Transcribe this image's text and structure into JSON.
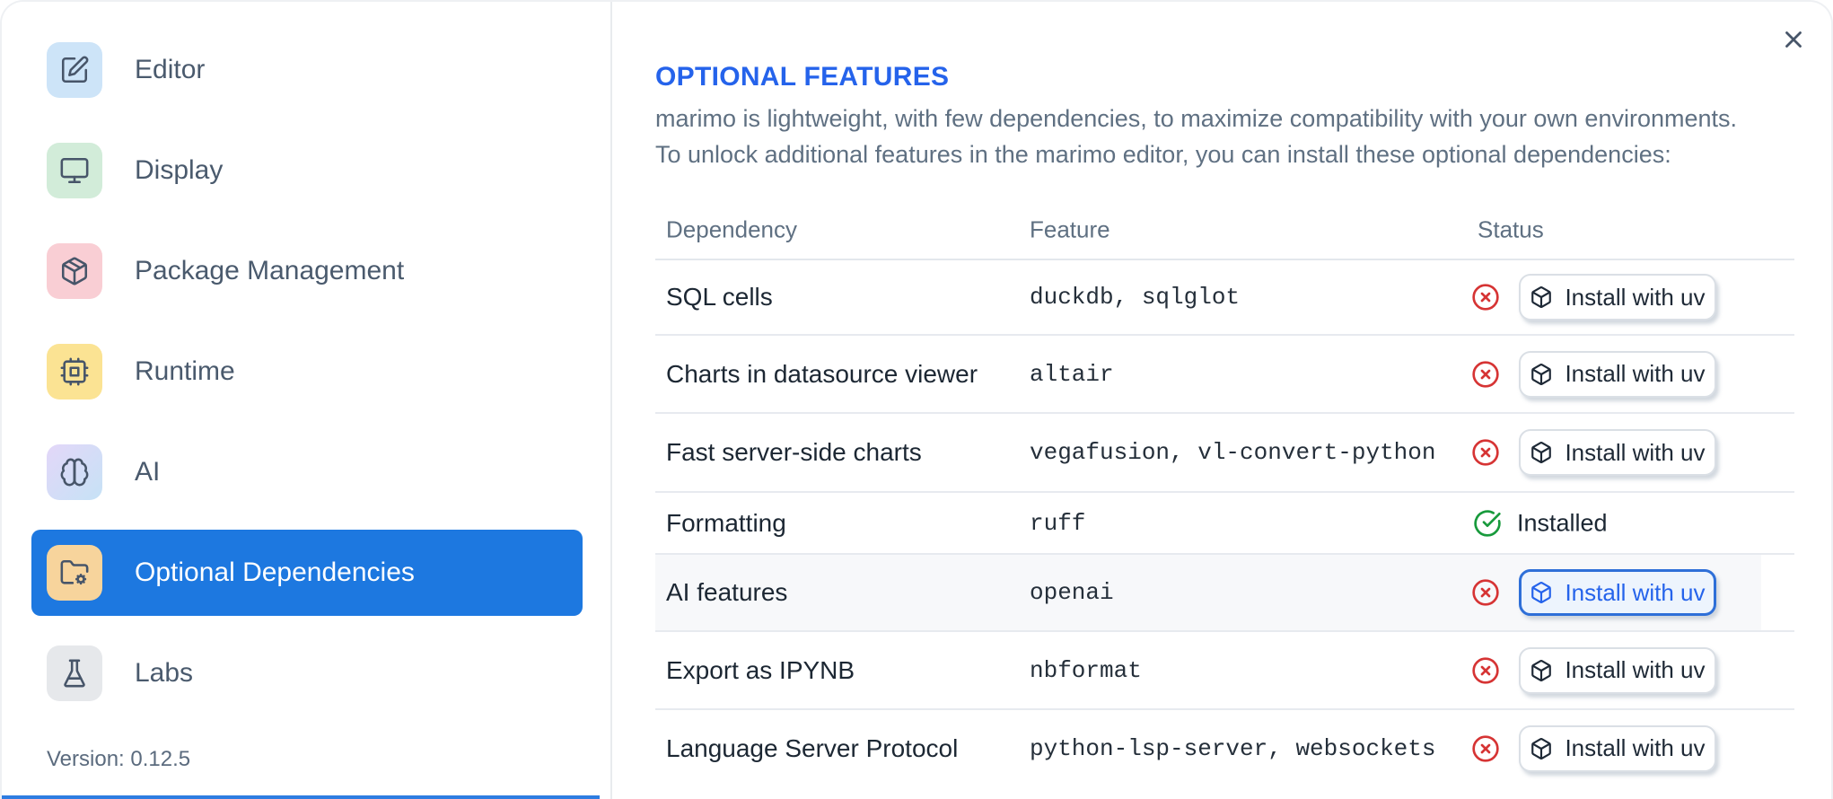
{
  "sidebar": {
    "items": [
      {
        "label": "Editor",
        "icon": "pencil-square"
      },
      {
        "label": "Display",
        "icon": "monitor"
      },
      {
        "label": "Package Management",
        "icon": "package"
      },
      {
        "label": "Runtime",
        "icon": "cpu"
      },
      {
        "label": "AI",
        "icon": "brain"
      },
      {
        "label": "Optional Dependencies",
        "icon": "folder-cog",
        "selected": true
      },
      {
        "label": "Labs",
        "icon": "flask"
      }
    ],
    "version_label": "Version: 0.12.5"
  },
  "dialog": {
    "title": "OPTIONAL FEATURES",
    "description_line1": "marimo is lightweight, with few dependencies, to maximize compatibility with your own environments.",
    "description_line2": "To unlock additional features in the marimo editor, you can install these optional dependencies:",
    "close_icon": "x"
  },
  "table": {
    "columns": [
      "Dependency",
      "Feature",
      "Status"
    ],
    "rows": [
      {
        "dependency": "SQL cells",
        "feature": "duckdb, sqlglot",
        "installed": false,
        "action": "Install with uv"
      },
      {
        "dependency": "Charts in datasource viewer",
        "feature": "altair",
        "installed": false,
        "action": "Install with uv"
      },
      {
        "dependency": "Fast server-side charts",
        "feature": "vegafusion, vl-convert-python",
        "installed": false,
        "action": "Install with uv"
      },
      {
        "dependency": "Formatting",
        "feature": "ruff",
        "installed": true,
        "status_label": "Installed"
      },
      {
        "dependency": "AI features",
        "feature": "openai",
        "installed": false,
        "action": "Install with uv",
        "highlighted": true
      },
      {
        "dependency": "Export as IPYNB",
        "feature": "nbformat",
        "installed": false,
        "action": "Install with uv"
      },
      {
        "dependency": "Language Server Protocol",
        "feature": "python-lsp-server, websockets",
        "installed": false,
        "action": "Install with uv"
      }
    ]
  },
  "icons": {
    "status_missing": "circle-x",
    "status_installed": "circle-check",
    "install_button": "box",
    "close": "x"
  },
  "colors": {
    "accent_blue": "#1d78e0",
    "title_blue": "#2563eb",
    "status_red": "#d63434",
    "status_green": "#189a3c",
    "row_highlight": "#f7f8fa",
    "border": "#e7eaef",
    "bottom_strip": "#2e7de1"
  }
}
